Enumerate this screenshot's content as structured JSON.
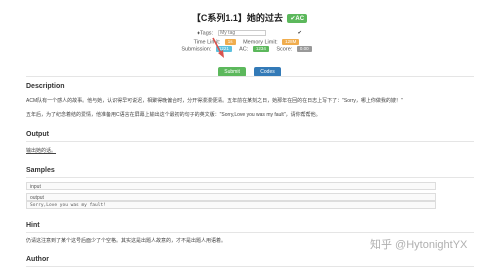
{
  "problem": {
    "title": "【C系列1.1】她的过去",
    "status_badge": "✔AC"
  },
  "meta": {
    "tags_label": "♦Tags:",
    "my_tag_placeholder": "My tag",
    "check_glyph": "✔",
    "time_limit_label": "Time Limit:",
    "time_limit_value": "1s",
    "memory_limit_label": "Memory Limit:",
    "memory_limit_value": "128M",
    "submission_label": "Submission:",
    "submission_value": "1221",
    "ac_label": "AC:",
    "ac_value": "1234",
    "score_label": "Score:",
    "score_value": "0.00"
  },
  "buttons": {
    "submit": "Submit",
    "codes": "Codes"
  },
  "description": {
    "heading": "Description",
    "line1": "ACM队有一个感人的故事。他与她，认识得早可说迟，相聚得晚偏合时，分开得漫漫便清。五年前在某刻之日，她那年在回的在日志上写下了：\"Sorry，哪上你做我的嫂！\"",
    "line2": "五年后，为了纪念着结的爱情，他准备用C语言在屏幕上输出这个最初的句子的英文版：\"Sorry,Love you was my fault\"，请你帮帮他。"
  },
  "output": {
    "heading": "Output",
    "text": "输出她的话。"
  },
  "samples": {
    "heading": "Samples",
    "input_label": "input",
    "output_label": "output",
    "output_value": "Sorry,Love you was my fault!"
  },
  "hint": {
    "heading": "Hint",
    "text": "仍请这注意到了某个这号后面少了个空格。其实这是出题人故意的，才不是出题人用语着。"
  },
  "author": {
    "heading": "Author"
  },
  "watermark": "知乎 @HytonightYX",
  "colors": {
    "success": "#5cb85c",
    "primary": "#337ab7",
    "warning": "#f0ad4e",
    "info": "#5bc0de",
    "arrow": "#d9534f"
  }
}
